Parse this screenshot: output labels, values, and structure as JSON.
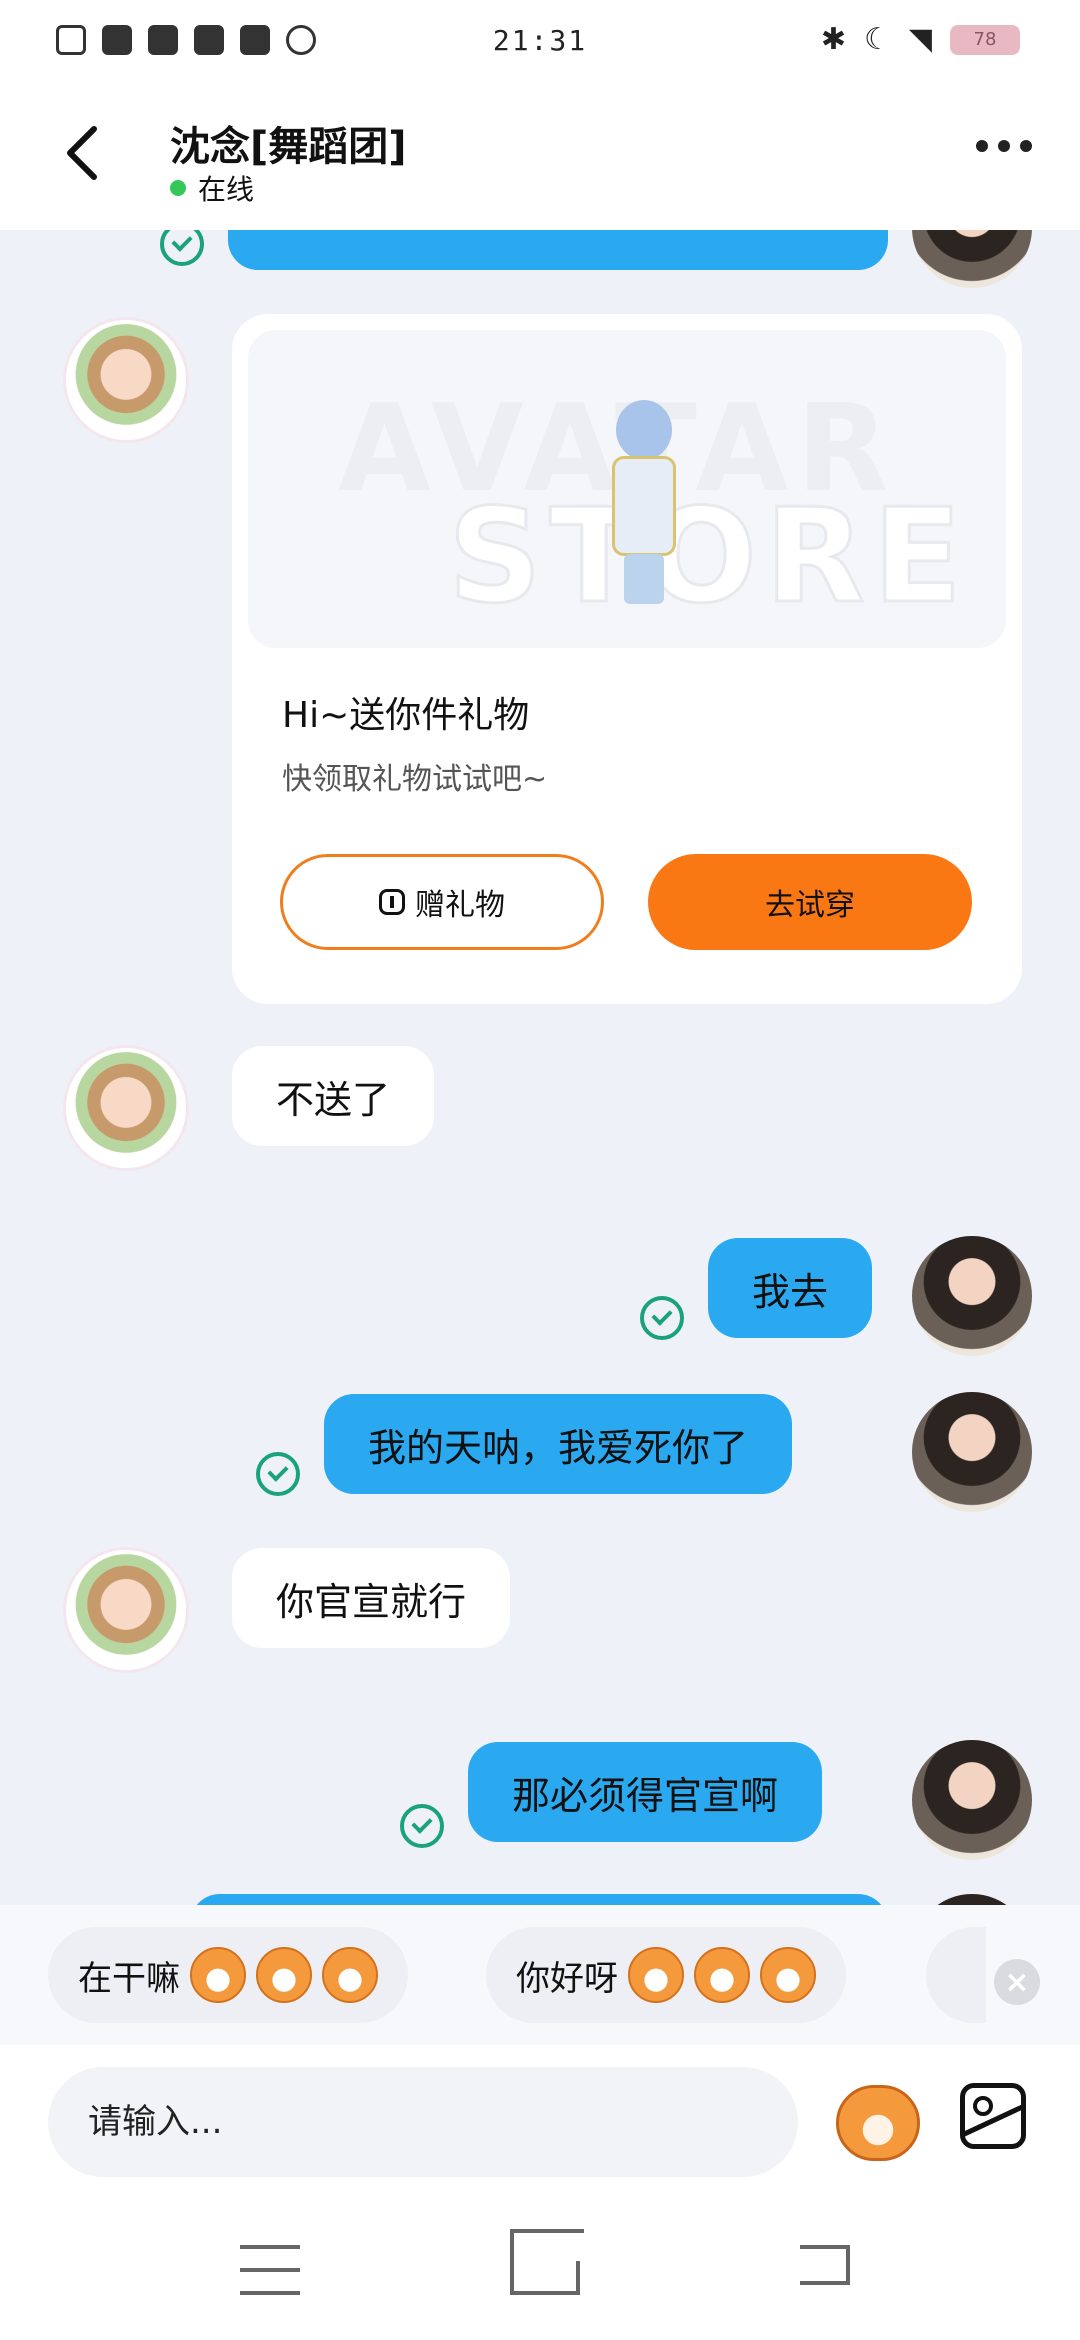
{
  "status_bar": {
    "time": "21:31",
    "battery": "78",
    "left_icons": [
      "sim-icon",
      "battery-saver-icon",
      "tiktok-icon",
      "play-icon",
      "wallet-icon",
      "leaf-icon"
    ],
    "right_icons": [
      "bluetooth-icon",
      "moon-icon",
      "wifi-icon"
    ]
  },
  "header": {
    "title": "沈念[舞蹈团]",
    "status": "在线",
    "status_color": "#34c759"
  },
  "gift_card": {
    "banner_watermark_1": "AVATAR",
    "banner_watermark_2": "STORE",
    "title": "Hi~送你件礼物",
    "subtitle": "快领取礼物试试吧~",
    "gift_button": "赠礼物",
    "try_button": "去试穿",
    "accent": "#fa7814"
  },
  "messages": [
    {
      "from": "friend",
      "text": "不送了"
    },
    {
      "from": "me",
      "text": "我去",
      "read": true
    },
    {
      "from": "me",
      "text": "我的天呐，我爱死你了",
      "read": true
    },
    {
      "from": "friend",
      "text": "你官宣就行"
    },
    {
      "from": "me",
      "text": "那必须得官宣啊",
      "read": true
    }
  ],
  "quick_replies": [
    {
      "text": "在干嘛",
      "emoji_count": 3
    },
    {
      "text": "你好呀",
      "emoji_count": 3
    }
  ],
  "input": {
    "placeholder": "请输入..."
  },
  "colors": {
    "outgoing_bubble": "#2aa8f0",
    "incoming_bubble": "#ffffff",
    "read_check": "#1aa37a",
    "chat_background": "#eef2f8"
  }
}
